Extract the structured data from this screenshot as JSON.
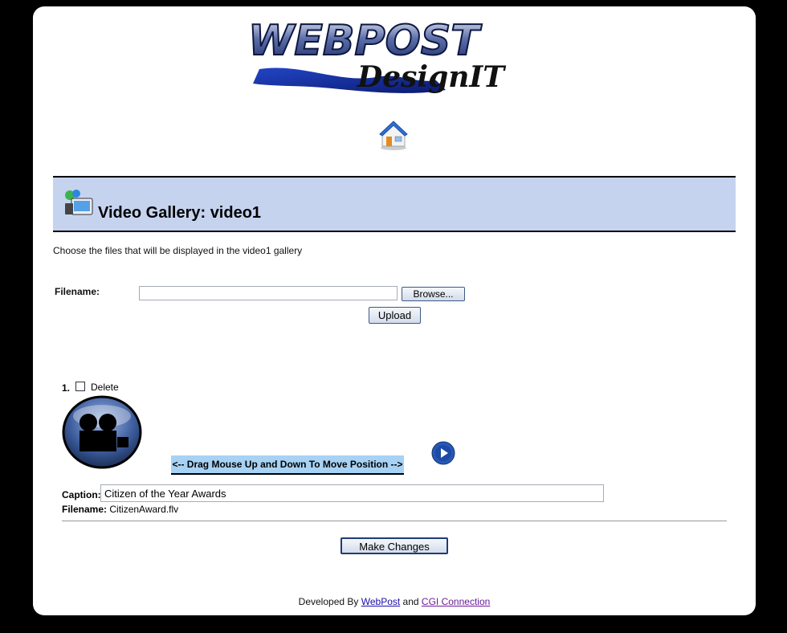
{
  "brand": {
    "logo_text": "WEBPOST DesignIT"
  },
  "nav": {
    "home_icon": "home-icon"
  },
  "header": {
    "title": "Video Gallery: video1",
    "icon": "gallery-icon"
  },
  "intro": "Choose the files that will be displayed in the video1 gallery",
  "upload": {
    "filename_label": "Filename:",
    "browse_label": "Browse...",
    "upload_label": "Upload",
    "file_value": ""
  },
  "items": [
    {
      "number": "1.",
      "delete_label": "Delete",
      "delete_checked": false,
      "drag_text": "<-- Drag Mouse Up and Down To Move Position -->",
      "caption_label": "Caption:",
      "caption": "Citizen of the Year Awards",
      "filename_label": "Filename:",
      "filename": "CitizenAward.flv"
    }
  ],
  "actions": {
    "make_changes": "Make Changes"
  },
  "footer": {
    "prefix": "Developed By",
    "link1": "WebPost",
    "conj": "and",
    "link2": "CGI Connection"
  },
  "colors": {
    "header_band": "#c5d3ef",
    "drag_band": "#a7d2f4",
    "link": "#1a0dab",
    "visited_link": "#6a1b9a"
  }
}
